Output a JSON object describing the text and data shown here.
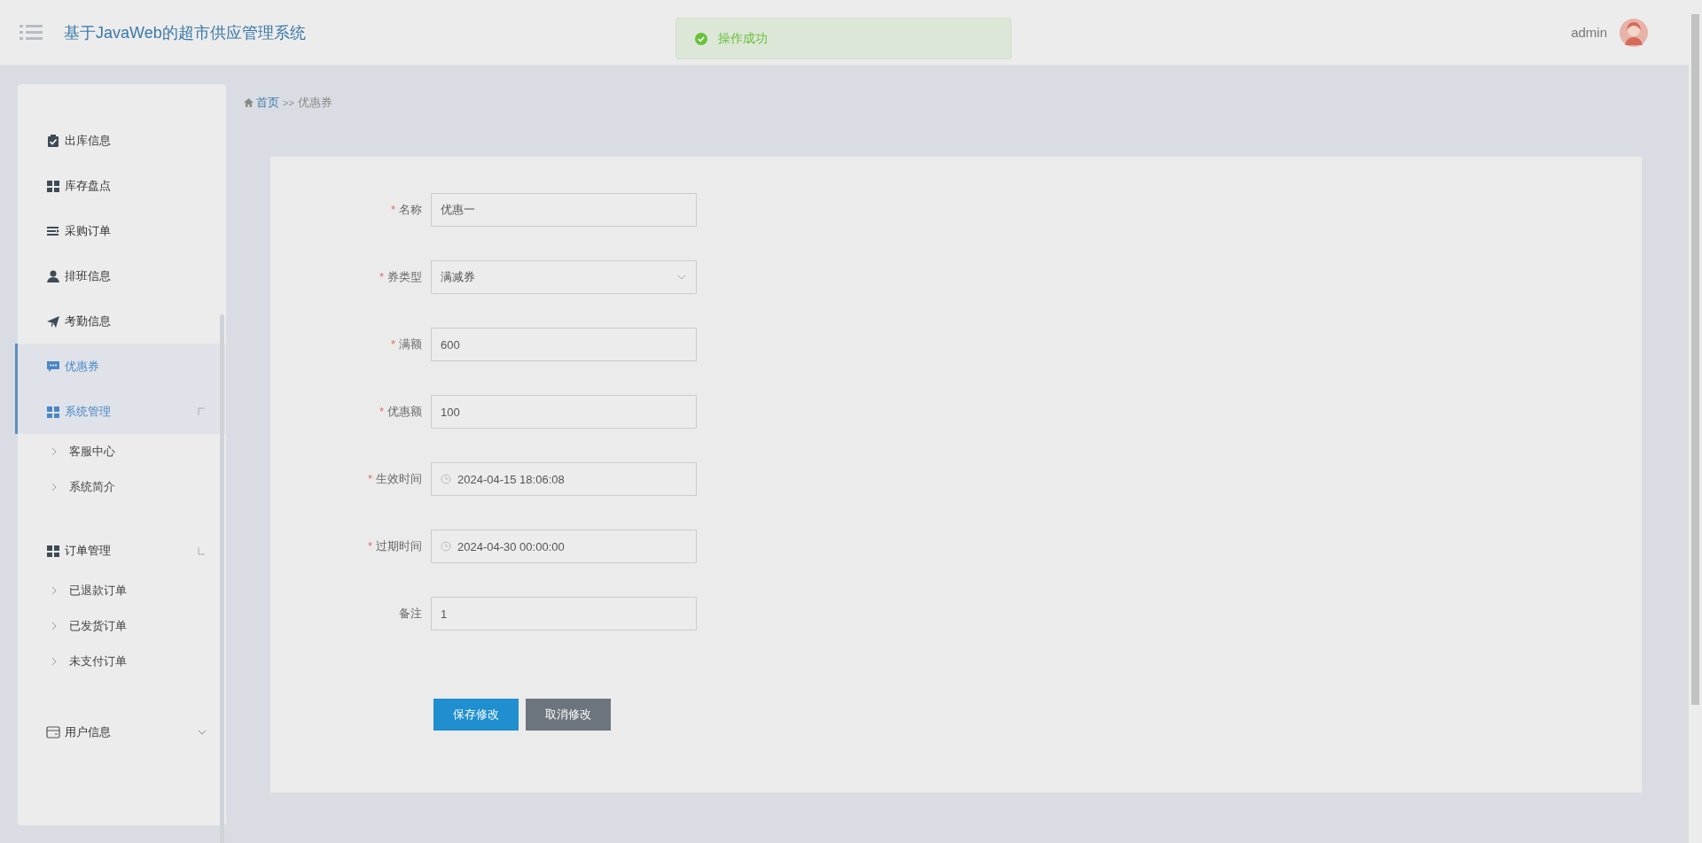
{
  "header": {
    "title": "基于JavaWeb的超市供应管理系统",
    "user": "admin"
  },
  "toast": {
    "message": "操作成功"
  },
  "sidebar": {
    "items": [
      {
        "label": "出库信息",
        "selected": false
      },
      {
        "label": "库存盘点",
        "selected": false
      },
      {
        "label": "采购订单",
        "selected": false
      },
      {
        "label": "排班信息",
        "selected": false
      },
      {
        "label": "考勤信息",
        "selected": false
      },
      {
        "label": "优惠券",
        "selected": true
      },
      {
        "label": "系统管理",
        "selected": true,
        "expanded": true,
        "children": [
          {
            "label": "客服中心"
          },
          {
            "label": "系统简介"
          }
        ]
      },
      {
        "label": "订单管理",
        "selected": false,
        "expanded": true,
        "children": [
          {
            "label": "已退款订单"
          },
          {
            "label": "已发货订单"
          },
          {
            "label": "未支付订单"
          }
        ]
      },
      {
        "label": "用户信息",
        "selected": false,
        "expanded": false
      }
    ]
  },
  "breadcrumb": {
    "home": "首页",
    "separator": ">>",
    "current": "优惠券"
  },
  "form": {
    "fields": [
      {
        "label": "名称",
        "mark": "*",
        "kind": "text",
        "value": "优惠一"
      },
      {
        "label": "券类型",
        "mark": "*",
        "kind": "select",
        "value": "满减券"
      },
      {
        "label": "满额",
        "mark": "*",
        "kind": "text",
        "value": "600"
      },
      {
        "label": "优惠额",
        "mark": "*",
        "kind": "text",
        "value": "100"
      },
      {
        "label": "生效时间",
        "mark": "*",
        "kind": "date",
        "value": "2024-04-15 18:06:08"
      },
      {
        "label": "过期时间",
        "mark": "*",
        "kind": "date",
        "value": "2024-04-30 00:00:00"
      },
      {
        "label": "备注",
        "kind": "text",
        "value": "1"
      }
    ],
    "buttons": [
      {
        "label": "保存修改",
        "kind": "primary"
      },
      {
        "label": "取消修改",
        "kind": "secondary"
      }
    ]
  }
}
